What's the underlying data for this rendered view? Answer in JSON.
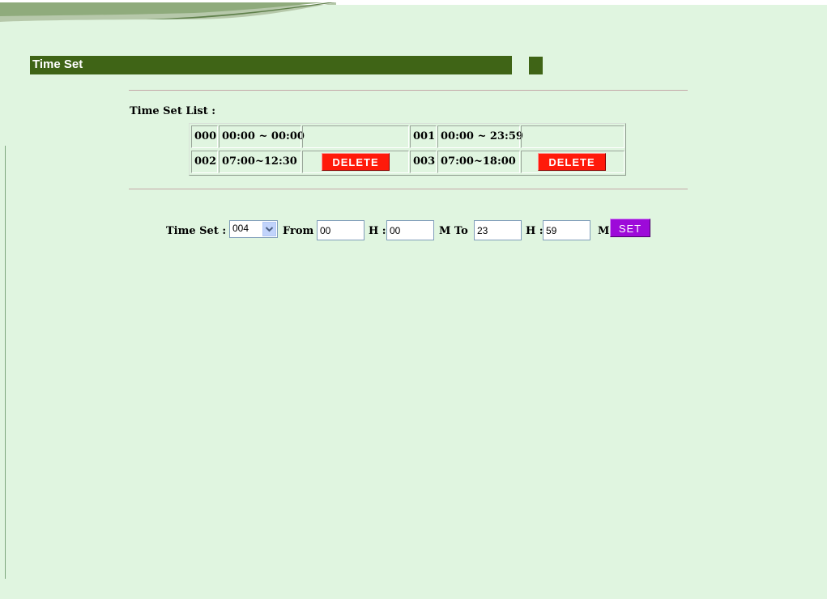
{
  "header": {
    "title": "Time Set"
  },
  "time_set_list": {
    "label": "Time Set List :",
    "rows": [
      [
        {
          "index": "000",
          "range": "00:00 ~ 00:00",
          "delete_label": ""
        },
        {
          "index": "001",
          "range": "00:00 ~ 23:59",
          "delete_label": ""
        }
      ],
      [
        {
          "index": "002",
          "range": "07:00~12:30",
          "delete_label": "DELETE"
        },
        {
          "index": "003",
          "range": "07:00~18:00",
          "delete_label": "DELETE"
        }
      ]
    ]
  },
  "form": {
    "time_set_label": "Time Set :",
    "time_set_value": "004",
    "from_label": "From",
    "from_hour": "00",
    "h_label_1": "H :",
    "from_minute": "00",
    "m_to_label": "M  To",
    "to_hour": "23",
    "h_label_2": "H :",
    "to_minute": "59",
    "m_label": "M",
    "set_label": "SET"
  },
  "colors": {
    "background": "#e0f5e0",
    "title_bar": "#3f6416",
    "delete_button": "#ff1a0a",
    "set_button": "#9d0ad9"
  }
}
